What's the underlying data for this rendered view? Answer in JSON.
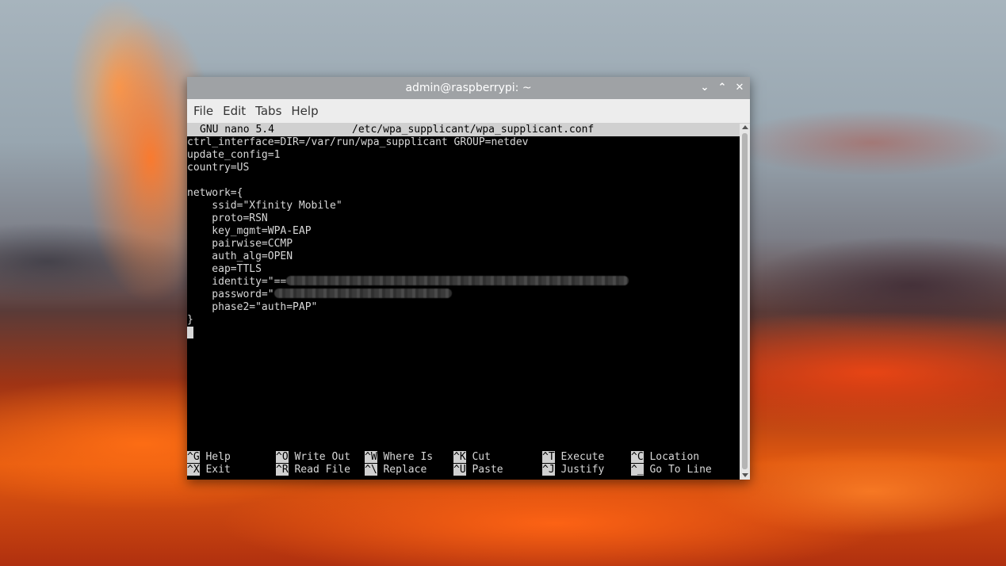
{
  "window": {
    "title": "admin@raspberrypi: ~",
    "controls": {
      "minimize": "⌄",
      "maximize": "⌃",
      "close": "✕"
    }
  },
  "menubar": [
    "File",
    "Edit",
    "Tabs",
    "Help"
  ],
  "nano": {
    "version": "GNU nano 5.4",
    "filename": "/etc/wpa_supplicant/wpa_supplicant.conf"
  },
  "file_lines": [
    "ctrl_interface=DIR=/var/run/wpa_supplicant GROUP=netdev",
    "update_config=1",
    "country=US",
    "",
    "network={",
    "    ssid=\"Xfinity Mobile\"",
    "    proto=RSN",
    "    key_mgmt=WPA-EAP",
    "    pairwise=CCMP",
    "    auth_alg=OPEN",
    "    eap=TTLS",
    "    identity=\"==",
    "    password=\"",
    "    phase2=\"auth=PAP\"",
    "}"
  ],
  "shortcuts": {
    "row1": [
      {
        "key": "^G",
        "label": " Help"
      },
      {
        "key": "^O",
        "label": " Write Out"
      },
      {
        "key": "^W",
        "label": " Where Is"
      },
      {
        "key": "^K",
        "label": " Cut"
      },
      {
        "key": "^T",
        "label": " Execute"
      },
      {
        "key": "^C",
        "label": " Location"
      }
    ],
    "row2": [
      {
        "key": "^X",
        "label": " Exit"
      },
      {
        "key": "^R",
        "label": " Read File"
      },
      {
        "key": "^\\",
        "label": " Replace"
      },
      {
        "key": "^U",
        "label": " Paste"
      },
      {
        "key": "^J",
        "label": " Justify"
      },
      {
        "key": "^_",
        "label": " Go To Line"
      }
    ]
  }
}
